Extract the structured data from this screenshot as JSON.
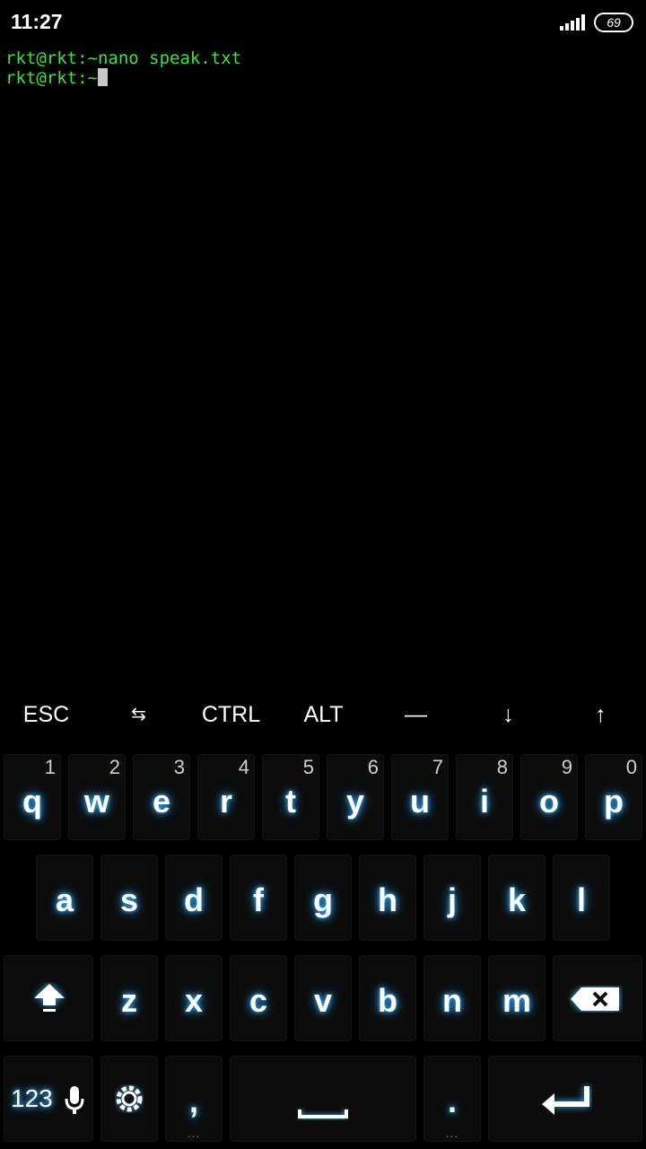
{
  "status_bar": {
    "time": "11:27",
    "battery": "69",
    "signal_icon": "signal-bars-icon"
  },
  "terminal": {
    "lines": [
      "rkt@rkt:~nano speak.txt",
      "rkt@rkt:~"
    ]
  },
  "extra_keys": [
    "ESC",
    "⇆",
    "CTRL",
    "ALT",
    "—",
    "↓",
    "↑"
  ],
  "keyboard": {
    "row1": [
      {
        "char": "q",
        "hint": "1"
      },
      {
        "char": "w",
        "hint": "2"
      },
      {
        "char": "e",
        "hint": "3"
      },
      {
        "char": "r",
        "hint": "4"
      },
      {
        "char": "t",
        "hint": "5"
      },
      {
        "char": "y",
        "hint": "6"
      },
      {
        "char": "u",
        "hint": "7"
      },
      {
        "char": "i",
        "hint": "8"
      },
      {
        "char": "o",
        "hint": "9"
      },
      {
        "char": "p",
        "hint": "0"
      }
    ],
    "row2": [
      "a",
      "s",
      "d",
      "f",
      "g",
      "h",
      "j",
      "k",
      "l"
    ],
    "row3": [
      "z",
      "x",
      "c",
      "v",
      "b",
      "n",
      "m"
    ],
    "row4": {
      "numbers_label": "123",
      "comma": ",",
      "period": ".",
      "more_dots": "..."
    }
  },
  "colors": {
    "terminal_green": "#39e339",
    "key_glow": "#3fb6ff",
    "background": "#000000"
  }
}
